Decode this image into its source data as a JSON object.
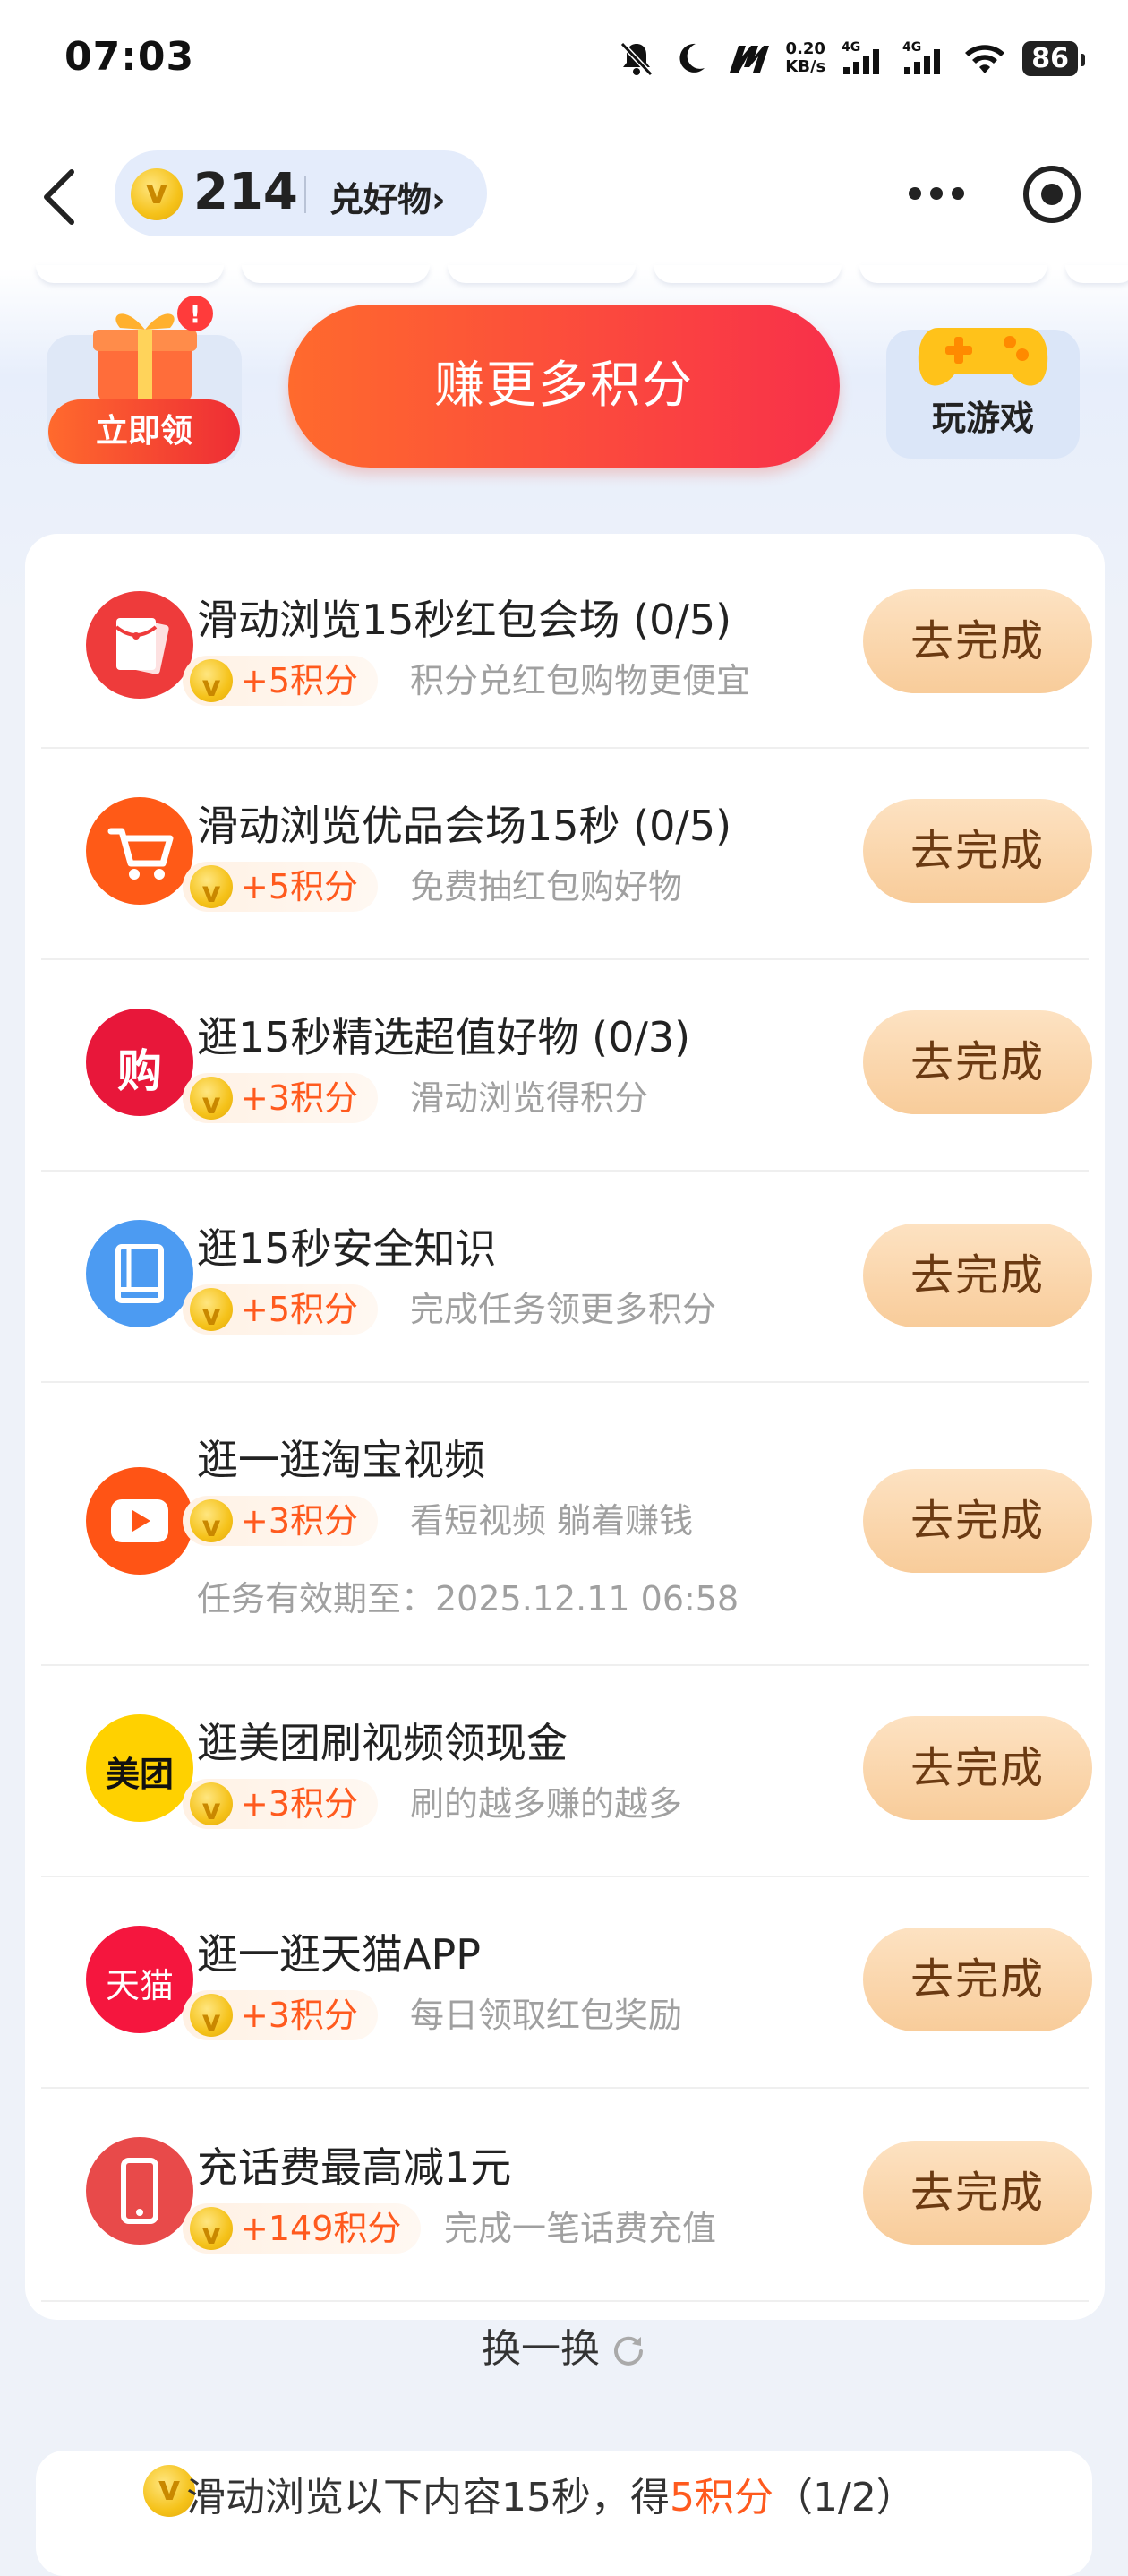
{
  "status": {
    "time": "07:03",
    "net_speed_value": "0.20",
    "net_speed_unit": "KB/s",
    "signal1_label": "4G",
    "signal2_label": "4G",
    "battery": "86"
  },
  "header": {
    "points": "214",
    "exchange_label": "兑好物›"
  },
  "actions": {
    "gift_label": "立即领",
    "earn_more_label": "赚更多积分",
    "game_label": "玩游戏"
  },
  "tasks": [
    {
      "title": "滑动浏览15秒红包会场 (0/5)",
      "reward": "+5积分",
      "desc": "积分兑红包购物更便宜",
      "button": "去完成",
      "icon": "red-envelope-icon",
      "color": "#ee3b3b"
    },
    {
      "title": "滑动浏览优品会场15秒 (0/5)",
      "reward": "+5积分",
      "desc": "免费抽红包购好物",
      "button": "去完成",
      "icon": "shopping-cart-icon",
      "color": "#ff5a17"
    },
    {
      "title": "逛15秒精选超值好物 (0/3)",
      "reward": "+3积分",
      "desc": "滑动浏览得积分",
      "button": "去完成",
      "icon": "buy-icon",
      "icon_text": "购",
      "color": "#e8173a"
    },
    {
      "title": "逛15秒安全知识",
      "reward": "+5积分",
      "desc": "完成任务领更多积分",
      "button": "去完成",
      "icon": "book-icon",
      "color": "#4c9bf2"
    },
    {
      "title": "逛一逛淘宝视频",
      "reward": "+3积分",
      "desc": "看短视频 躺着赚钱",
      "extra": "任务有效期至：2025.12.11 06:58",
      "button": "去完成",
      "icon": "video-play-icon",
      "color": "#ff5415"
    },
    {
      "title": "逛美团刷视频领现金",
      "reward": "+3积分",
      "desc": "刷的越多赚的越多",
      "button": "去完成",
      "icon": "meituan-icon",
      "icon_text": "美团",
      "color": "#ffd100"
    },
    {
      "title": "逛一逛天猫APP",
      "reward": "+3积分",
      "desc": "每日领取红包奖励",
      "button": "去完成",
      "icon": "tmall-icon",
      "icon_text": "天猫",
      "color": "#f5163e"
    },
    {
      "title": "充话费最高减1元",
      "reward": "+149积分",
      "desc": "完成一笔话费充值",
      "button": "去完成",
      "icon": "phone-icon",
      "color": "#e84a4a"
    }
  ],
  "refresh_label": "换一换",
  "bottom": {
    "text_prefix": "滑动浏览以下内容15秒，得",
    "text_highlight": "5积分",
    "text_suffix": "（1/2）"
  }
}
